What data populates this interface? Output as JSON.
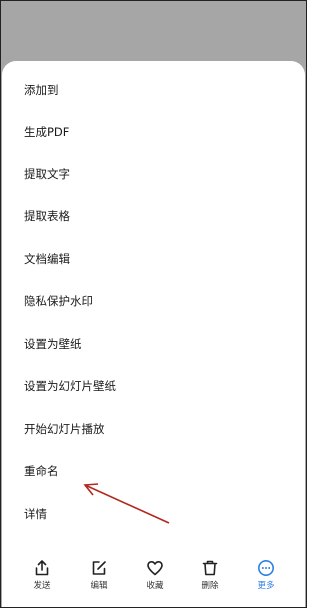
{
  "menu": {
    "items": [
      {
        "label": "添加到"
      },
      {
        "label": "生成PDF"
      },
      {
        "label": "提取文字"
      },
      {
        "label": "提取表格"
      },
      {
        "label": "文档编辑"
      },
      {
        "label": "隐私保护水印"
      },
      {
        "label": "设置为壁纸"
      },
      {
        "label": "设置为幻灯片壁纸"
      },
      {
        "label": "开始幻灯片播放"
      },
      {
        "label": "重命名"
      },
      {
        "label": "详情"
      }
    ]
  },
  "bottom_bar": {
    "items": [
      {
        "label": "发送",
        "icon": "share-icon"
      },
      {
        "label": "编辑",
        "icon": "edit-icon"
      },
      {
        "label": "收藏",
        "icon": "heart-icon"
      },
      {
        "label": "删除",
        "icon": "trash-icon"
      },
      {
        "label": "更多",
        "icon": "more-icon",
        "active": true
      }
    ],
    "accent_color": "#2f7fe6"
  },
  "annotation": {
    "color": "#b0281e"
  }
}
